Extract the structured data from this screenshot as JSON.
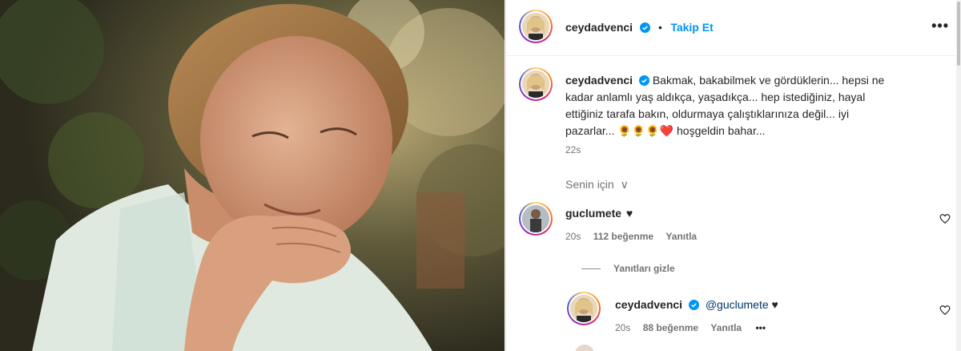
{
  "post": {
    "username": "ceydadvenci",
    "follow_label": "Takip Et",
    "follow_separator": "•",
    "more_label": "•••",
    "caption_username": "ceydadvenci",
    "caption_text_line1": "Bakmak, bakabilmek ve gördüklerin... hepsi ne",
    "caption_text_line2": "kadar anlamlı yaş aldıkça, yaşadıkça... hep istediğiniz, hayal",
    "caption_text_line3": "ettiğiniz tarafa bakın, oldurmaya çalıştıklarınıza değil... iyi",
    "caption_text_line4a": "pazarlar...",
    "caption_emojis": "🌻🌻🌻❤️",
    "caption_text_line4b": "hoşgeldin bahar...",
    "caption_time": "22s"
  },
  "filter": {
    "label": "Senin için",
    "chevron": "∨"
  },
  "comments": [
    {
      "username": "guclumete",
      "text": "♥",
      "time": "20s",
      "likes": "112 beğenme",
      "reply_label": "Yanıtla"
    }
  ],
  "replies_toggle": "Yanıtları gizle",
  "replies": [
    {
      "username": "ceydadvenci",
      "mention": "@guclumete",
      "text": "♥",
      "time": "20s",
      "likes": "88 beğenme",
      "reply_label": "Yanıtla",
      "more_label": "•••"
    }
  ],
  "colors": {
    "accent": "#0095f6",
    "verified": "#0095f6",
    "text": "#262626",
    "muted": "#737373"
  }
}
